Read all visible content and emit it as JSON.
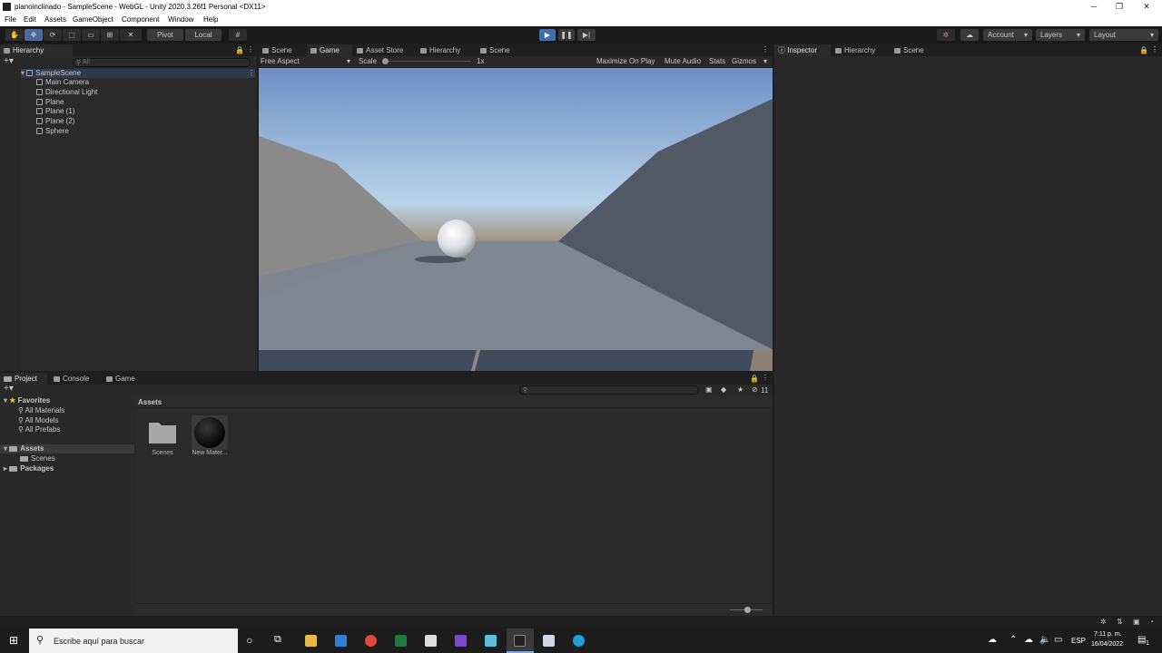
{
  "window": {
    "title": "planoinclinado - SampleScene - WebGL - Unity 2020.3.26f1 Personal <DX11>",
    "minimize": "─",
    "maximize": "❐",
    "close": "✕"
  },
  "menu": [
    "File",
    "Edit",
    "Assets",
    "GameObject",
    "Component",
    "Window",
    "Help"
  ],
  "toolbar": {
    "pivot": "Pivot",
    "local": "Local",
    "account": "Account",
    "layers": "Layers",
    "layout": "Layout",
    "caret": "▾"
  },
  "hierarchy": {
    "tab": "Hierarchy",
    "add": "+▾",
    "search_placeholder": "All",
    "scene": "SampleScene",
    "items": [
      "Main Camera",
      "Directional Light",
      "Plane",
      "Plane (1)",
      "Plane (2)",
      "Sphere"
    ]
  },
  "center_tabs": [
    "Scene",
    "Game",
    "Asset Store",
    "Hierarchy",
    "Scene"
  ],
  "game_toolbar": {
    "aspect": "Free Aspect",
    "scale_label": "Scale",
    "scale_value": "1x",
    "maximize": "Maximize On Play",
    "mute": "Mute Audio",
    "stats": "Stats",
    "gizmos": "Gizmos"
  },
  "inspector_tabs": [
    "Inspector",
    "Hierarchy",
    "Scene"
  ],
  "bottom_tabs": [
    "Project",
    "Console",
    "Game"
  ],
  "project": {
    "add": "+▾",
    "favorites": "Favorites",
    "fav_items": [
      "All Materials",
      "All Models",
      "All Prefabs"
    ],
    "assets": "Assets",
    "asset_children": [
      "Scenes"
    ],
    "packages": "Packages",
    "breadcrumb": "Assets",
    "count": "11",
    "files": [
      {
        "name": "Scenes",
        "type": "folder"
      },
      {
        "name": "New Mater...",
        "type": "material"
      }
    ]
  },
  "taskbar": {
    "search_placeholder": "Escribe aquí para buscar",
    "lang": "ESP",
    "time": "7:11 p. m.",
    "date": "16/04/2022",
    "notif": "1"
  }
}
